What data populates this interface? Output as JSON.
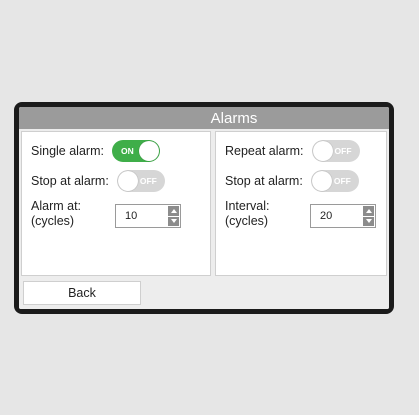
{
  "window": {
    "title": "Alarms"
  },
  "left": {
    "single_alarm": {
      "label": "Single alarm:",
      "state": "ON",
      "on": true
    },
    "stop_at_alarm": {
      "label": "Stop at alarm:",
      "state": "OFF",
      "on": false
    },
    "alarm_at": {
      "label_line1": "Alarm at:",
      "label_line2": "(cycles)",
      "value": "10"
    }
  },
  "right": {
    "repeat_alarm": {
      "label": "Repeat alarm:",
      "state": "OFF",
      "on": false
    },
    "stop_at_alarm": {
      "label": "Stop at alarm:",
      "state": "OFF",
      "on": false
    },
    "interval": {
      "label_line1": "Interval:",
      "label_line2": "(cycles)",
      "value": "20"
    }
  },
  "footer": {
    "back_label": "Back"
  },
  "colors": {
    "toggle_on": "#3fae49",
    "toggle_off": "#d6d6d6",
    "titlebar": "#9b9b9b"
  }
}
